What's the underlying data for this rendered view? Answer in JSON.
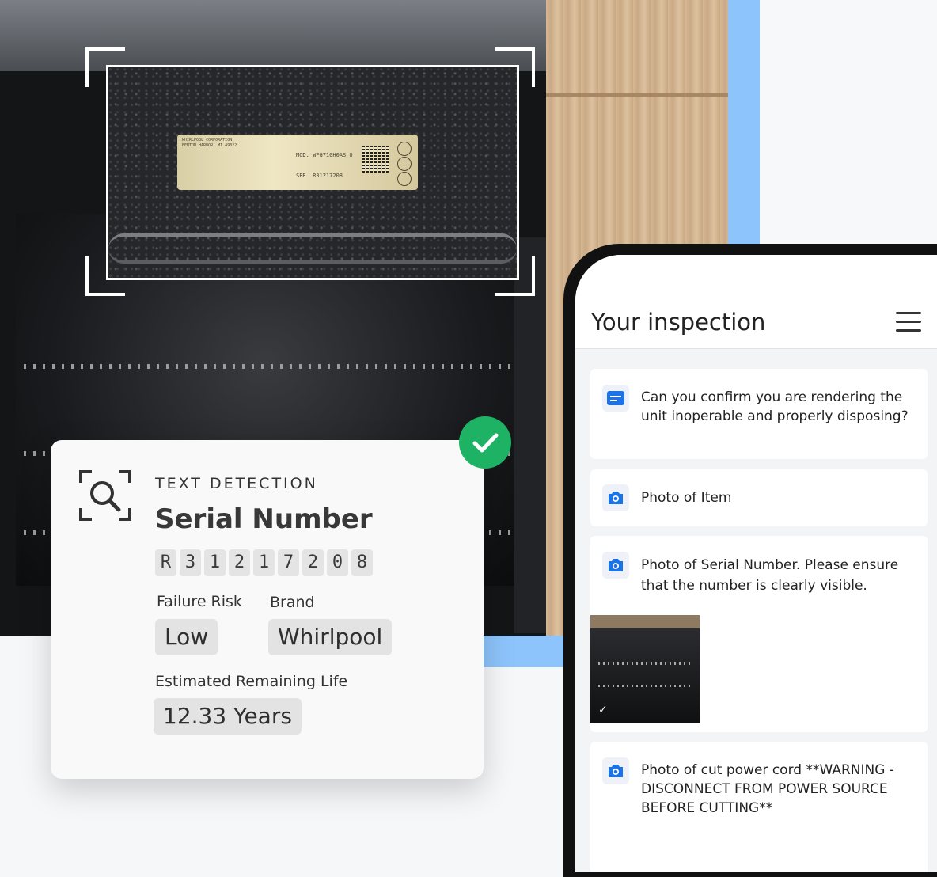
{
  "scan_plate": {
    "maker_line": "WHIRLPOOL CORPORATION",
    "city_line": "BENTON HARBOR, MI 49022",
    "mod_label": "MOD. WFG710H0AS 0",
    "ser_label": "SER. R31217208"
  },
  "detection_card": {
    "eyebrow": "TEXT DETECTION",
    "title": "Serial Number",
    "serial_chars": [
      "R",
      "3",
      "1",
      "2",
      "1",
      "7",
      "2",
      "0",
      "8"
    ],
    "failure_risk_label": "Failure Risk",
    "failure_risk_value": "Low",
    "brand_label": "Brand",
    "brand_value": "Whirlpool",
    "remaining_life_label": "Estimated Remaining Life",
    "remaining_life_value": "12.33 Years"
  },
  "inspection": {
    "title": "Your inspection",
    "items": [
      {
        "icon": "form-icon",
        "text": "Can you confirm you are rendering the unit inoperable and properly disposing?"
      },
      {
        "icon": "camera-icon",
        "text": "Photo of Item"
      },
      {
        "icon": "camera-icon",
        "text": "Photo of Serial Number. Please ensure that the number is clearly visible."
      },
      {
        "icon": "camera-icon",
        "text": "Photo of cut power cord **WARNING - DISCONNECT FROM POWER SOURCE BEFORE CUTTING**"
      }
    ]
  },
  "colors": {
    "accent_blue": "#1a73e8",
    "success_green": "#1eb364",
    "sky_blue": "#8dc4fb"
  }
}
